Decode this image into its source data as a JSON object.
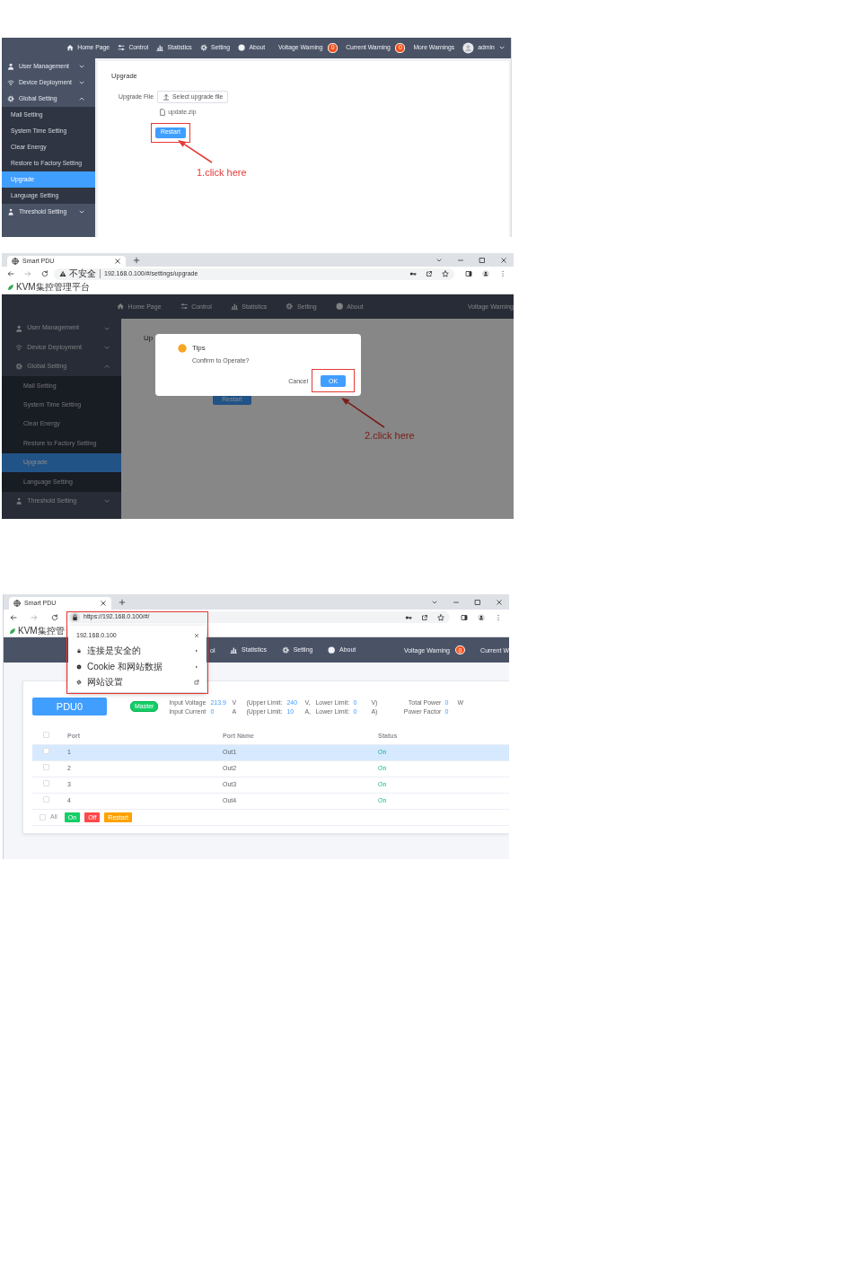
{
  "screenshot_1": {
    "app": {
      "nav_items": [
        {
          "label": "Home Page",
          "kind": "home"
        },
        {
          "label": "Control",
          "kind": "control"
        },
        {
          "label": "Statistics",
          "kind": "statistics"
        },
        {
          "label": "Setting",
          "kind": "setting"
        },
        {
          "label": "About",
          "kind": "about"
        }
      ],
      "warnings": [
        {
          "label": "Voltage Warning",
          "count": "0"
        },
        {
          "label": "Current Warning",
          "count": "0"
        },
        {
          "label": "More Warnings"
        }
      ],
      "user": "admin",
      "sidebar": [
        {
          "label": "User Management",
          "kind": "user",
          "expanded": false
        },
        {
          "label": "Device Deployment",
          "kind": "device",
          "expanded": false
        },
        {
          "label": "Global Setting",
          "kind": "global",
          "expanded": true,
          "children": [
            {
              "label": "Mail Setting",
              "selected": false
            },
            {
              "label": "System Time Setting",
              "selected": false
            },
            {
              "label": "Clear Energy",
              "selected": false
            },
            {
              "label": "Restore to Factory Setting",
              "selected": false
            },
            {
              "label": "Upgrade",
              "selected": true
            },
            {
              "label": "Language Setting",
              "selected": false
            }
          ]
        },
        {
          "label": "Threshold Setting",
          "kind": "threshold",
          "expanded": false
        }
      ]
    },
    "page_title": "Upgrade",
    "upgrade_file_label": "Upgrade File",
    "select_file_button": "Select upgrade file",
    "file_name": "update.zip",
    "restart_button": "Restart",
    "callout_text": "1.click here"
  },
  "screenshot_2": {
    "browser": {
      "tab_title": "Smart PDU",
      "address": {
        "security_label": "不安全",
        "url": "192.168.0.100/#/settings/upgrade"
      },
      "bookmark": "KVM集控管理平台"
    },
    "app": {
      "nav_items": [
        {
          "label": "Home Page",
          "kind": "home"
        },
        {
          "label": "Control",
          "kind": "control"
        },
        {
          "label": "Statistics",
          "kind": "statistics"
        },
        {
          "label": "Setting",
          "kind": "setting"
        },
        {
          "label": "About",
          "kind": "about"
        }
      ],
      "warnings": [
        {
          "label": "Voltage Warning"
        }
      ],
      "sidebar": [
        {
          "label": "User Management",
          "kind": "user",
          "expanded": false
        },
        {
          "label": "Device Deployment",
          "kind": "device",
          "expanded": false
        },
        {
          "label": "Global Setting",
          "kind": "global",
          "expanded": true,
          "children": [
            {
              "label": "Mail Setting",
              "selected": false
            },
            {
              "label": "System Time Setting",
              "selected": false
            },
            {
              "label": "Clear Energy",
              "selected": false
            },
            {
              "label": "Restore to Factory Setting",
              "selected": false
            },
            {
              "label": "Upgrade",
              "selected": true
            },
            {
              "label": "Language Setting",
              "selected": false
            }
          ]
        },
        {
          "label": "Threshold Setting",
          "kind": "threshold",
          "expanded": false
        }
      ]
    },
    "page_title": "Up",
    "restart_button": "Restart",
    "dialog": {
      "title": "Tips",
      "message": "Confirm to Operate?",
      "cancel_button": "Cancel",
      "ok_button": "OK"
    },
    "callout_text": "2.click here"
  },
  "screenshot_3": {
    "browser": {
      "tab_title": "Smart PDU",
      "address": {
        "url": "https://192.168.0.100/#/"
      },
      "bookmark": "KVM集控管"
    },
    "site_info_popup": {
      "host": "192.168.0.100",
      "items": [
        {
          "label": "连接是安全的",
          "kind": "lock"
        },
        {
          "label": "Cookie 和网站数据",
          "kind": "cookie"
        },
        {
          "label": "网站设置",
          "kind": "settings"
        }
      ]
    },
    "app": {
      "nav_items": [
        {
          "label": "ol",
          "kind": "none"
        },
        {
          "label": "Statistics",
          "kind": "statistics"
        },
        {
          "label": "Setting",
          "kind": "setting"
        },
        {
          "label": "About",
          "kind": "about"
        }
      ],
      "warnings": [
        {
          "label": "Voltage Warning",
          "count": "0"
        },
        {
          "label": "Current W"
        }
      ]
    },
    "device": {
      "name": "PDU0",
      "role": "Master",
      "readings": [
        {
          "label": "Input Voltage",
          "value": "213.9",
          "unit": "V",
          "upper_label": "(Upper Limit:",
          "upper": "240",
          "upper_unit": "V,",
          "lower_label": "Lower Limit:",
          "lower": "0",
          "lower_unit": "V)",
          "total_label": "Total Power",
          "total_value": "0",
          "total_unit": "W"
        },
        {
          "label": "Input Current",
          "value": "0",
          "unit": "A",
          "upper_label": "(Upper Limit:",
          "upper": "10",
          "upper_unit": "A,",
          "lower_label": "Lower Limit:",
          "lower": "0",
          "lower_unit": "A)",
          "total_label": "Power Factor",
          "total_value": "0"
        }
      ]
    },
    "table": {
      "select_all_checked": false,
      "columns": [
        "Port",
        "Port Name",
        "Status"
      ],
      "rows": [
        {
          "port": "1",
          "name": "Out1",
          "status": "On",
          "selected": true,
          "checked": false
        },
        {
          "port": "2",
          "name": "Out2",
          "status": "On",
          "selected": false,
          "checked": false
        },
        {
          "port": "3",
          "name": "Out3",
          "status": "On",
          "selected": false,
          "checked": false
        },
        {
          "port": "4",
          "name": "Out4",
          "status": "On",
          "selected": false,
          "checked": false
        }
      ]
    },
    "footer": {
      "all_label": "All",
      "all_checked": false,
      "buttons": [
        {
          "label": "On",
          "kind": "on"
        },
        {
          "label": "Off",
          "kind": "off"
        },
        {
          "label": "Restart",
          "kind": "restart"
        }
      ]
    }
  }
}
